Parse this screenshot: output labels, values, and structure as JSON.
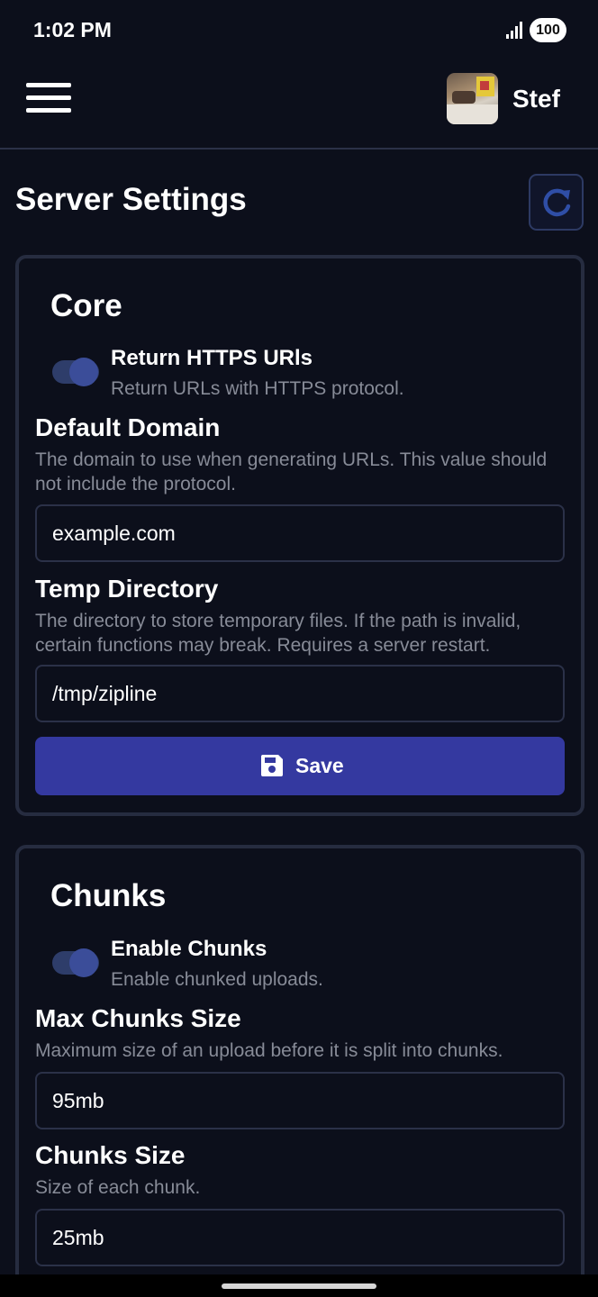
{
  "status_bar": {
    "time": "1:02 PM",
    "battery": "100",
    "signal_icon": "signal-icon"
  },
  "header": {
    "menu_icon": "menu-icon",
    "username": "Stef"
  },
  "page": {
    "title": "Server Settings",
    "refresh_icon": "refresh-icon"
  },
  "core": {
    "title": "Core",
    "https_toggle": {
      "label": "Return HTTPS URls",
      "description": "Return URLs with HTTPS protocol.",
      "enabled": true
    },
    "default_domain": {
      "label": "Default Domain",
      "description": "The domain to use when generating URLs. This value should not include the protocol.",
      "value": "example.com"
    },
    "temp_directory": {
      "label": "Temp Directory",
      "description": "The directory to store temporary files. If the path is invalid, certain functions may break. Requires a server restart.",
      "value": "/tmp/zipline"
    },
    "save_label": "Save",
    "save_icon": "floppy-disk-icon"
  },
  "chunks": {
    "title": "Chunks",
    "enable_toggle": {
      "label": "Enable Chunks",
      "description": "Enable chunked uploads.",
      "enabled": true
    },
    "max_chunks_size": {
      "label": "Max Chunks Size",
      "description": "Maximum size of an upload before it is split into chunks.",
      "value": "95mb"
    },
    "chunks_size": {
      "label": "Chunks Size",
      "description": "Size of each chunk.",
      "value": "25mb"
    }
  },
  "colors": {
    "background": "#0c0f1b",
    "card_border": "#262c40",
    "accent": "#3439a0",
    "toggle_track": "#2e3d6a",
    "muted_text": "#878b97"
  }
}
